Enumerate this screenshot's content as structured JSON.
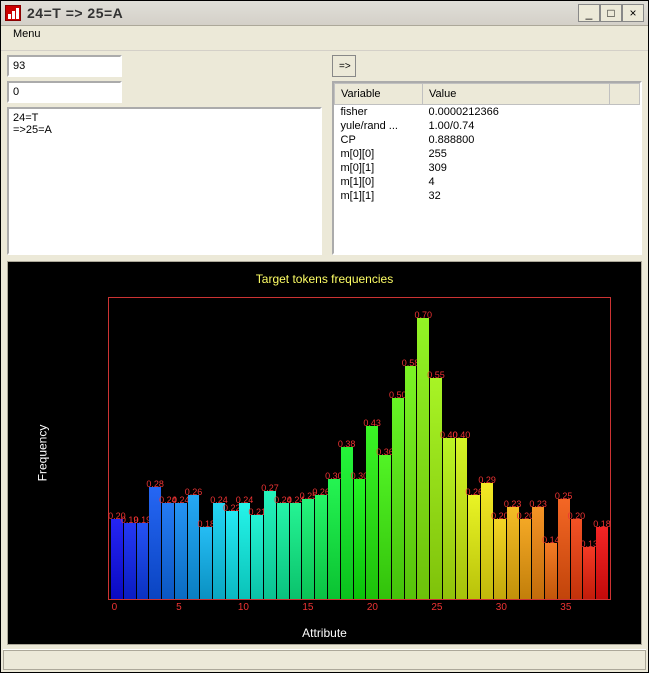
{
  "window": {
    "title": "24=T => 25=A",
    "icon_name": "histogram-app-icon"
  },
  "menubar": {
    "items": [
      "Menu"
    ]
  },
  "inputs": {
    "field1": "93",
    "field2": "0",
    "rule_text": "24=T\n=>25=A"
  },
  "go_button_label": "=>",
  "table": {
    "headers": [
      "Variable",
      "Value"
    ],
    "rows": [
      {
        "var": "fisher",
        "val": "0.0000212366"
      },
      {
        "var": "yule/rand ...",
        "val": "1.00/0.74"
      },
      {
        "var": "CP",
        "val": "0.888800"
      },
      {
        "var": "m[0][0]",
        "val": "255"
      },
      {
        "var": "m[0][1]",
        "val": "309"
      },
      {
        "var": "m[1][0]",
        "val": "4"
      },
      {
        "var": "m[1][1]",
        "val": "32"
      }
    ]
  },
  "chart_data": {
    "type": "bar",
    "title": "Target tokens frequencies",
    "xlabel": "Attribute",
    "ylabel": "Frequency",
    "ylim": [
      0,
      0.75
    ],
    "xticks": [
      0,
      5,
      10,
      15,
      20,
      25,
      30,
      35
    ],
    "categories": [
      0,
      1,
      2,
      3,
      4,
      5,
      6,
      7,
      8,
      9,
      10,
      11,
      12,
      13,
      14,
      15,
      16,
      17,
      18,
      19,
      20,
      21,
      22,
      23,
      24,
      25,
      26,
      27,
      28,
      29,
      30,
      31,
      32,
      33,
      34,
      35,
      36,
      37,
      38
    ],
    "values": [
      0.2,
      0.19,
      0.19,
      0.28,
      0.24,
      0.24,
      0.26,
      0.18,
      0.24,
      0.22,
      0.24,
      0.21,
      0.27,
      0.24,
      0.24,
      0.25,
      0.26,
      0.3,
      0.38,
      0.3,
      0.43,
      0.36,
      0.5,
      0.58,
      0.7,
      0.55,
      0.4,
      0.4,
      0.26,
      0.29,
      0.2,
      0.23,
      0.2,
      0.23,
      0.14,
      0.25,
      0.2,
      0.13,
      0.18
    ]
  }
}
